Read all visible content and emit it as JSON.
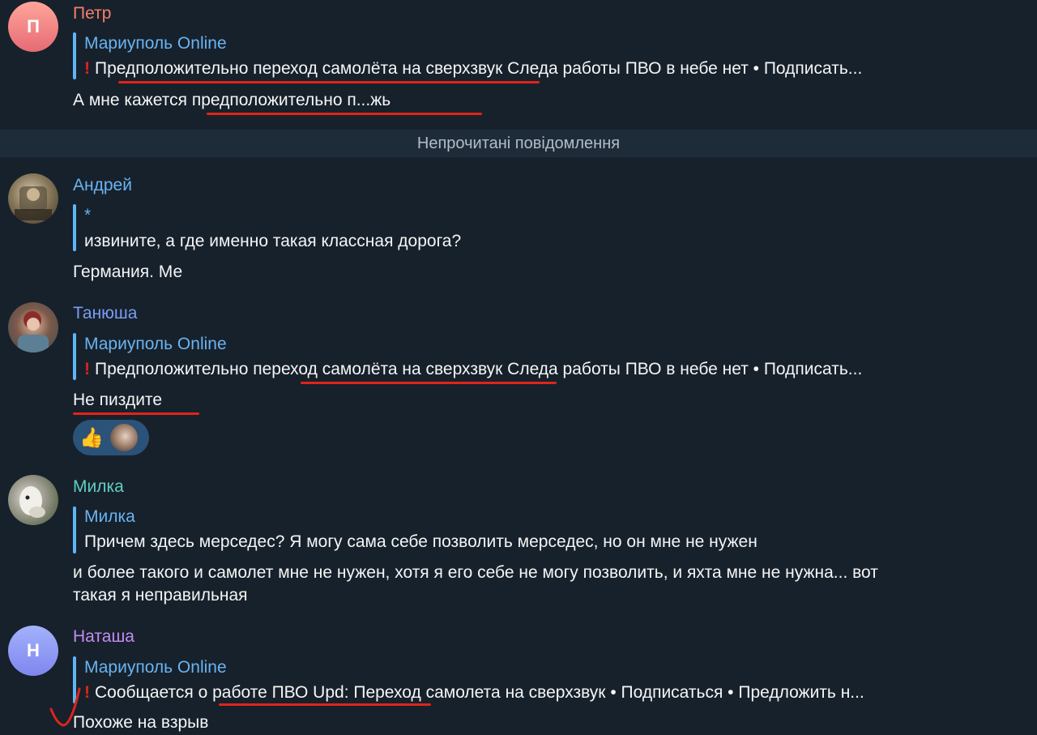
{
  "messages": [
    {
      "sender": "Петр",
      "avatar_letter": "П",
      "reply_title": "Мариуполь Online",
      "reply_text": "Предположительно переход самолёта на сверхзвук   Следа работы ПВО в небе нет  • Подписать...",
      "text": "А мне кажется предположительно п...жь"
    },
    {
      "sender": "Андрей",
      "reply_title": "*",
      "reply_text": "извините, а где именно такая классная дорога?",
      "text": "Германия. Ме"
    },
    {
      "sender": "Танюша",
      "reply_title": "Мариуполь Online",
      "reply_text": "Предположительно переход самолёта на сверхзвук   Следа работы ПВО в небе нет  • Подписать...",
      "text": "Не пиздите",
      "reaction_emoji": "👍"
    },
    {
      "sender": "Милка",
      "reply_title": "Милка",
      "reply_text": "Причем здесь мерседес? Я могу сама себе позволить мерседес, но он мне не нужен",
      "text_line1": "и более такого и самолет мне не нужен, хотя я его себе не могу позволить, и яхта мне не нужна... вот",
      "text_line2": "такая я неправильная"
    },
    {
      "sender": "Наташа",
      "avatar_letter": "Н",
      "reply_title": "Мариуполь Online",
      "reply_text": "Сообщается о работе ПВО  Upd: Переход самолета на сверхзвук   • Подписаться • Предложить н...",
      "text": "Похоже на взрыв"
    }
  ],
  "separator_label": "Непрочитані повідомлення",
  "colors": {
    "background": "#17212b",
    "reply_bar": "#5eb5f7",
    "reply_title": "#6ab3f3",
    "underline": "#e0241b",
    "name_petr": "#f57e6e",
    "name_andrey": "#6ab3f3",
    "name_tanyusha": "#7b9cf4",
    "name_milka": "#5fd0c2",
    "name_natasha": "#c18cf3"
  }
}
